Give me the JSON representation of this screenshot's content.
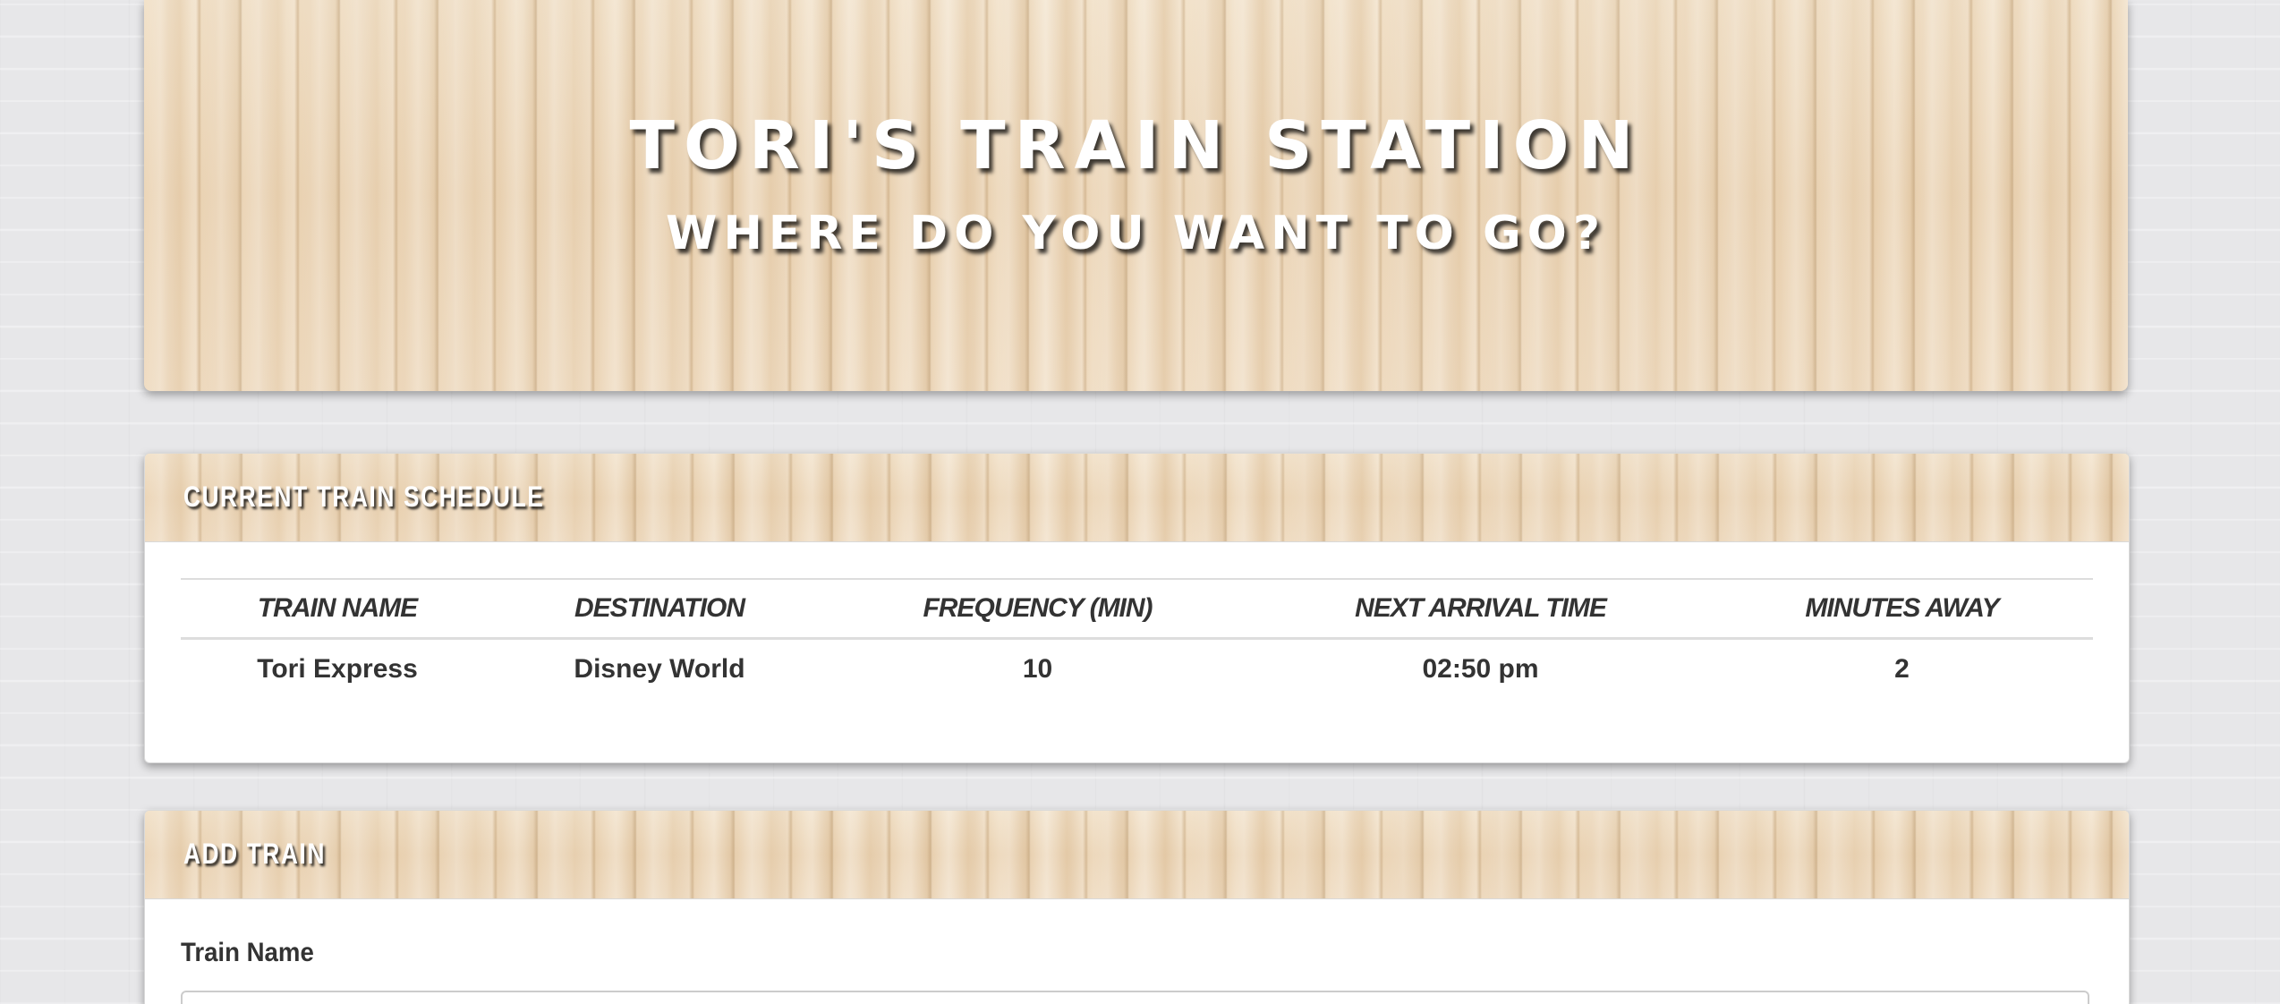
{
  "header": {
    "title": "TORI'S TRAIN STATION",
    "subtitle": "WHERE DO YOU WANT TO GO?"
  },
  "schedule": {
    "heading": "CURRENT TRAIN SCHEDULE",
    "columns": [
      "TRAIN NAME",
      "DESTINATION",
      "FREQUENCY (MIN)",
      "NEXT ARRIVAL TIME",
      "MINUTES AWAY"
    ],
    "rows": [
      {
        "train_name": "Tori Express",
        "destination": "Disney World",
        "frequency": "10",
        "next_arrival": "02:50 pm",
        "minutes_away": "2"
      }
    ]
  },
  "add_train": {
    "heading": "ADD TRAIN",
    "train_name_label": "Train Name",
    "train_name_value": ""
  },
  "colors": {
    "page_background": "#e7e7e9",
    "wood": "#efdcc1",
    "panel_background": "#ffffff",
    "text": "#333333",
    "heading_text": "#ffffff"
  }
}
